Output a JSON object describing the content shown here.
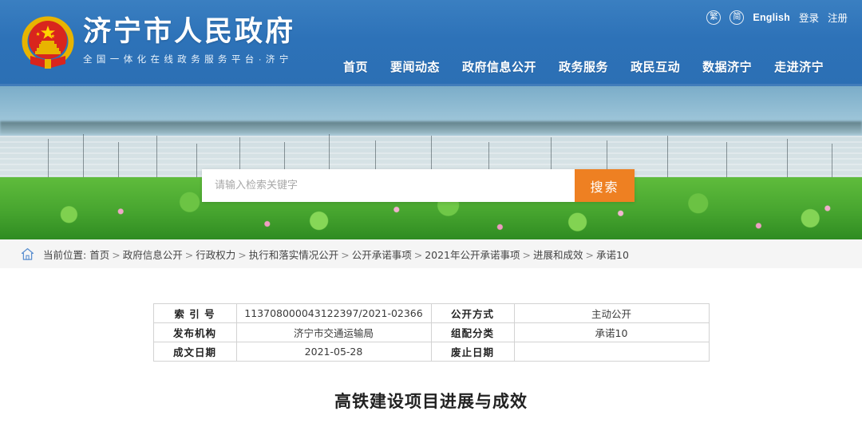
{
  "header": {
    "brand_title": "济宁市人民政府",
    "brand_subtitle": "全国一体化在线政务服务平台·济宁",
    "emblem_icon": "china-national-emblem-icon",
    "utils": [
      {
        "label": "繁",
        "name": "traditional-chinese-toggle",
        "type": "badge"
      },
      {
        "label": "简",
        "name": "simplified-chinese-toggle",
        "type": "badge"
      },
      {
        "label": "English",
        "name": "english-link",
        "type": "link"
      },
      {
        "label": "登录",
        "name": "login-link",
        "type": "link"
      },
      {
        "label": "注册",
        "name": "register-link",
        "type": "link"
      }
    ],
    "nav": [
      {
        "label": "首页",
        "name": "nav-home"
      },
      {
        "label": "要闻动态",
        "name": "nav-news"
      },
      {
        "label": "政府信息公开",
        "name": "nav-gov-info"
      },
      {
        "label": "政务服务",
        "name": "nav-services"
      },
      {
        "label": "政民互动",
        "name": "nav-interaction"
      },
      {
        "label": "数据济宁",
        "name": "nav-data"
      },
      {
        "label": "走进济宁",
        "name": "nav-about"
      }
    ],
    "colors": {
      "header_blue": "#2d72b8",
      "accent_orange": "#ee8022"
    }
  },
  "banner": {
    "alt": "微山湖荷花与渔船风景图",
    "search": {
      "placeholder": "请输入检索关键字",
      "value": "",
      "button_label": "搜索"
    }
  },
  "breadcrumb": {
    "home_icon": "home-icon",
    "label": "当前位置:",
    "items": [
      "首页",
      "政府信息公开",
      "行政权力",
      "执行和落实情况公开",
      "公开承诺事项",
      "2021年公开承诺事项",
      "进展和成效",
      "承诺10"
    ],
    "separator": ">"
  },
  "info_table": {
    "rows": [
      {
        "k1": "索 引 号",
        "v1": "113708000043122397/2021-02366",
        "k2": "公开方式",
        "v2": "主动公开"
      },
      {
        "k1": "发布机构",
        "v1": "济宁市交通运输局",
        "k2": "组配分类",
        "v2": "承诺10"
      },
      {
        "k1": "成文日期",
        "v1": "2021-05-28",
        "k2": "废止日期",
        "v2": ""
      }
    ]
  },
  "article": {
    "title": "高铁建设项目进展与成效"
  }
}
